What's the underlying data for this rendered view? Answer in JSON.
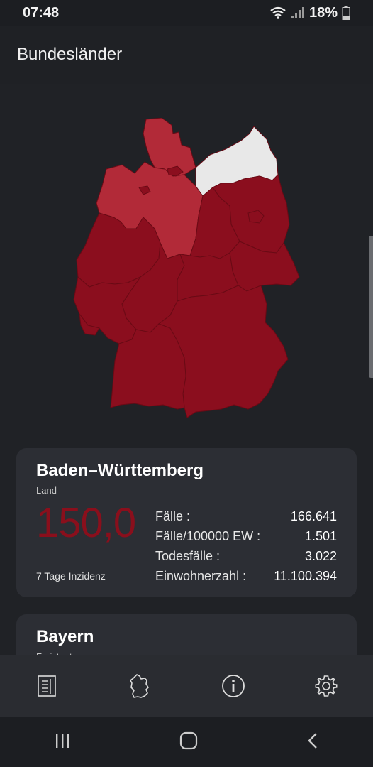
{
  "status_bar": {
    "time": "07:48",
    "battery": "18%"
  },
  "app_bar": {
    "title": "Bundesländer"
  },
  "map": {
    "colors": {
      "high": "#8b0e1e",
      "medium": "#b22a38",
      "low": "#e8e8e8",
      "border": "#6a0a15"
    }
  },
  "states": [
    {
      "name": "Baden–Württemberg",
      "type": "Land",
      "incidence": "150,0",
      "incidence_label": "7 Tage Inzidenz",
      "stats": [
        {
          "label": "Fälle :",
          "value": "166.641"
        },
        {
          "label": "Fälle/100000 EW :",
          "value": "1.501"
        },
        {
          "label": "Todesfälle :",
          "value": "3.022"
        },
        {
          "label": "Einwohnerzahl :",
          "value": "11.100.394"
        }
      ]
    },
    {
      "name": "Bayern",
      "type": "Freistaat"
    }
  ],
  "bottom_nav": {
    "items": [
      {
        "icon": "list-icon"
      },
      {
        "icon": "germany-map-icon"
      },
      {
        "icon": "info-icon"
      },
      {
        "icon": "gear-icon"
      }
    ]
  },
  "accent_color": "#8a0f1c"
}
